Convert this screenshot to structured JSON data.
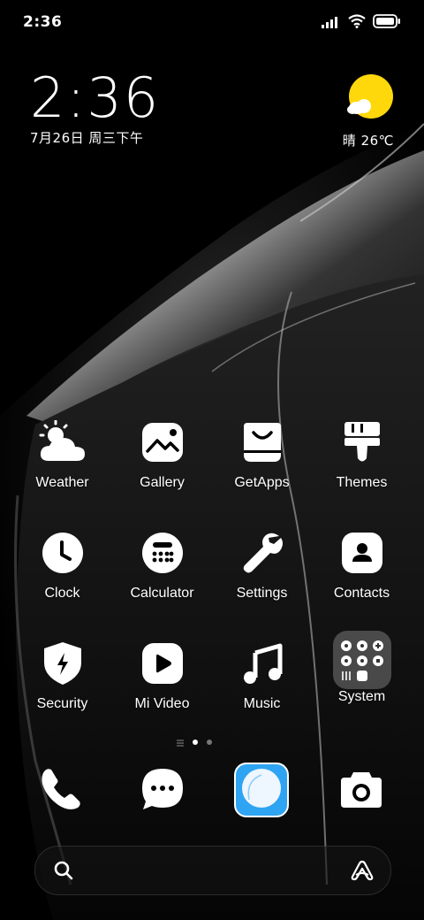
{
  "status_bar": {
    "time": "2:36",
    "icons": [
      "signal-icon",
      "wifi-icon",
      "battery-icon"
    ]
  },
  "clock_widget": {
    "time": "2:36",
    "date": "7月26日 周三下午"
  },
  "weather_widget": {
    "condition_temp": "晴 26℃",
    "icon": "sun-icon",
    "sun_color": "#FFD80C"
  },
  "apps": [
    {
      "label": "Weather",
      "icon": "weather-icon"
    },
    {
      "label": "Gallery",
      "icon": "gallery-icon"
    },
    {
      "label": "GetApps",
      "icon": "getapps-icon"
    },
    {
      "label": "Themes",
      "icon": "themes-icon"
    },
    {
      "label": "Clock",
      "icon": "clock-icon"
    },
    {
      "label": "Calculator",
      "icon": "calculator-icon"
    },
    {
      "label": "Settings",
      "icon": "settings-wrench-icon"
    },
    {
      "label": "Contacts",
      "icon": "contacts-icon"
    },
    {
      "label": "Security",
      "icon": "security-shield-icon"
    },
    {
      "label": "Mi Video",
      "icon": "play-icon"
    },
    {
      "label": "Music",
      "icon": "music-note-icon"
    },
    {
      "label": "System",
      "icon": "folder-icon"
    }
  ],
  "page_indicator": {
    "pages": 2,
    "current": 1
  },
  "dock": [
    {
      "icon": "phone-icon"
    },
    {
      "icon": "messages-icon"
    },
    {
      "icon": "browser-icon",
      "color": "#2FA4F2"
    },
    {
      "icon": "camera-icon"
    }
  ],
  "search_bar": {
    "icons": [
      "search-icon",
      "assistant-icon"
    ]
  }
}
